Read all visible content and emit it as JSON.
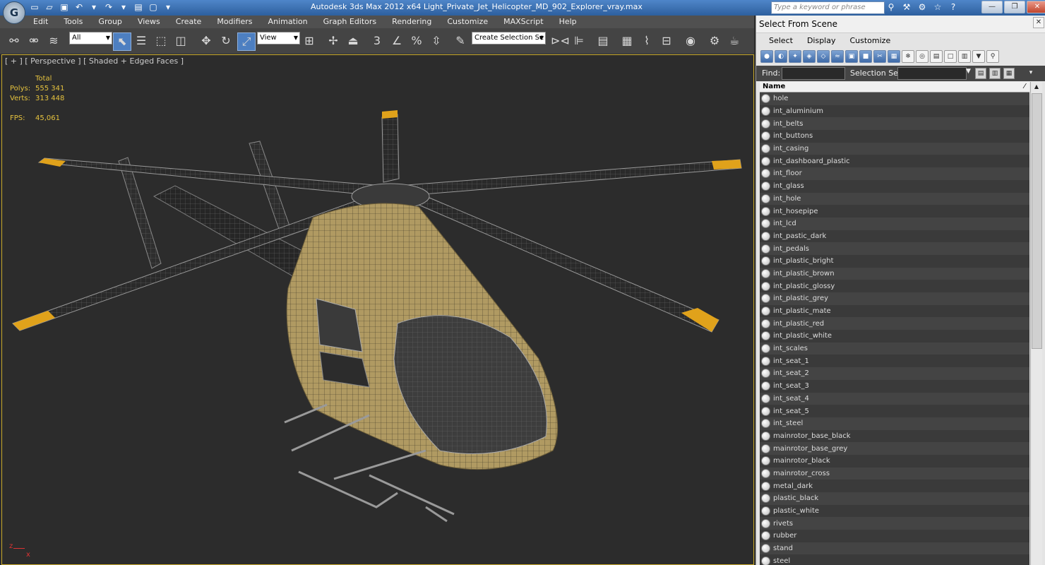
{
  "app": {
    "logo": "G",
    "title": "Autodesk 3ds Max  2012 x64     Light_Private_Jet_Helicopter_MD_902_Explorer_vray.max",
    "search_placeholder": "Type a keyword or phrase"
  },
  "menu": [
    "Edit",
    "Tools",
    "Group",
    "Views",
    "Create",
    "Modifiers",
    "Animation",
    "Graph Editors",
    "Rendering",
    "Customize",
    "MAXScript",
    "Help"
  ],
  "toolbar": {
    "filter_value": "All",
    "coord_value": "View",
    "selection_set_value": "Create Selection Se",
    "snap_labels": [
      "3",
      "%"
    ]
  },
  "viewport": {
    "label": "[ + ] [ Perspective ] [ Shaded + Edged Faces ]",
    "stats": {
      "total_label": "Total",
      "polys_label": "Polys:",
      "polys_value": "555 341",
      "verts_label": "Verts:",
      "verts_value": "313 448",
      "fps_label": "FPS:",
      "fps_value": "45,061"
    },
    "axis_x": "x",
    "axis_z": "z"
  },
  "panel": {
    "title": "Select From Scene",
    "menu": [
      "Select",
      "Display",
      "Customize"
    ],
    "find_label": "Find:",
    "find_value": "",
    "selection_set_label": "Selection Set:",
    "column_header": "Name",
    "items": [
      "hole",
      "int_aluminium",
      "int_belts",
      "int_buttons",
      "int_casing",
      "int_dashboard_plastic",
      "int_floor",
      "int_glass",
      "int_hole",
      "int_hosepipe",
      "int_lcd",
      "int_pastic_dark",
      "int_pedals",
      "int_plastic_bright",
      "int_plastic_brown",
      "int_plastic_glossy",
      "int_plastic_grey",
      "int_plastic_mate",
      "int_plastic_red",
      "int_plastic_white",
      "int_scales",
      "int_seat_1",
      "int_seat_2",
      "int_seat_3",
      "int_seat_4",
      "int_seat_5",
      "int_steel",
      "mainrotor_base_black",
      "mainrotor_base_grey",
      "mainrotor_black",
      "mainrotor_cross",
      "metal_dark",
      "plastic_black",
      "plastic_white",
      "rivets",
      "rubber",
      "stand",
      "steel"
    ]
  },
  "colors": {
    "title_bar": "#3a6fb0",
    "stats_text": "#e5c23e",
    "fuselage": "#b09a62",
    "rotor_tip": "#e0a21b",
    "viewport_border": "#c8a92a"
  }
}
